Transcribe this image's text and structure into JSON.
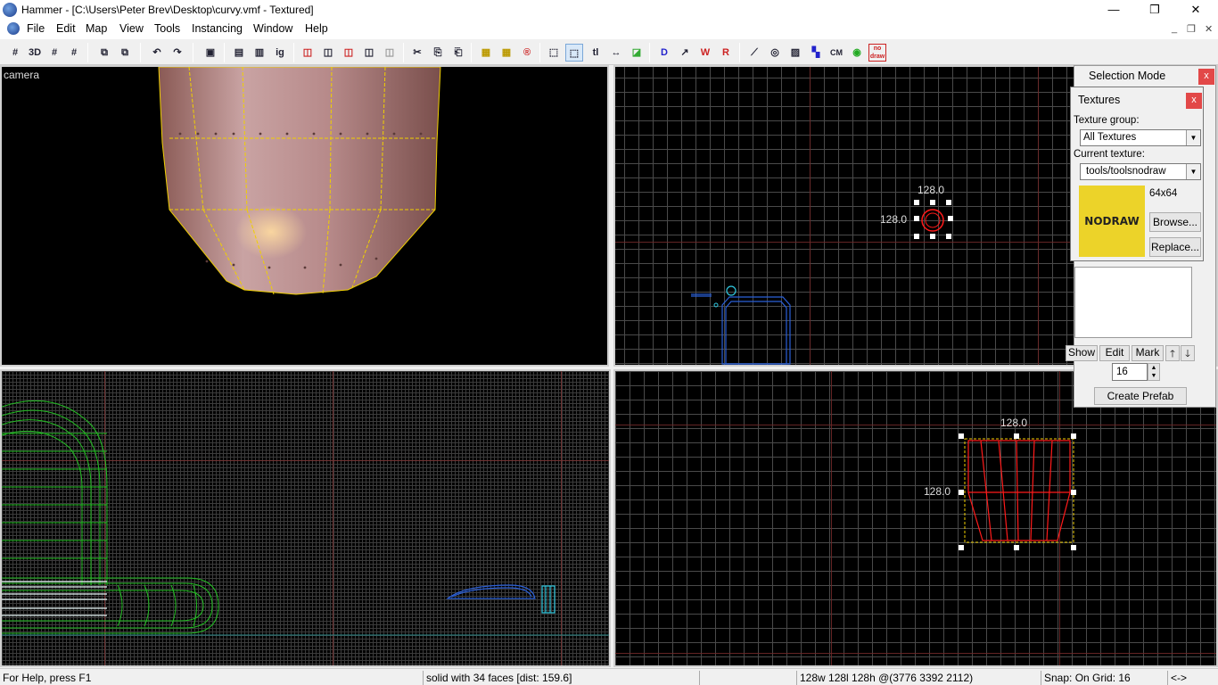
{
  "window": {
    "title": "Hammer - [C:\\Users\\Peter Brev\\Desktop\\curvy.vmf - Textured]",
    "minimize": "—",
    "maximize": "❐",
    "close": "✕"
  },
  "menu": {
    "items": [
      "File",
      "Edit",
      "Map",
      "View",
      "Tools",
      "Instancing",
      "Window",
      "Help"
    ],
    "mdi_min": "_",
    "mdi_restore": "❐",
    "mdi_close": "✕"
  },
  "toolbar": {
    "buttons": [
      "#",
      "3D",
      "#",
      "#",
      "⧉",
      "⧉",
      "↶",
      "↷",
      "▣",
      "▤",
      "▥",
      "ig",
      "◫",
      "◫",
      "◫",
      "◫",
      "◫",
      "✂",
      "⎘",
      "⎗",
      "▦",
      "▦",
      "®",
      "⬚",
      "⬚",
      "tl",
      "↔",
      "◪",
      "D",
      "↗",
      "W",
      "R",
      "⟋",
      "◎",
      "▨",
      "▚",
      "CM",
      "◉",
      "no draw"
    ]
  },
  "viewports": {
    "camera_label": "camera",
    "top_dims": {
      "w": "128.0",
      "h": "128.0"
    },
    "side_dims": {
      "w": "128.0",
      "h": "128.0"
    }
  },
  "selection_mode_panel": {
    "title": "Selection Mode",
    "close": "x"
  },
  "textures_panel": {
    "title": "Textures",
    "close": "x",
    "texture_group_label": "Texture group:",
    "texture_group_value": "All Textures",
    "current_texture_label": "Current texture:",
    "current_texture_value": "tools/toolsnodraw",
    "texture_size": "64x64",
    "texture_preview_text": "NODRAW",
    "browse": "Browse...",
    "replace": "Replace..."
  },
  "visgroup_panel": {
    "show": "Show",
    "edit": "Edit",
    "mark": "Mark",
    "up": "🡑",
    "down": "🡓",
    "spin_value": "16",
    "create_prefab": "Create Prefab"
  },
  "status": {
    "help": "For Help, press F1",
    "selection": "solid with 34 faces  [dist: 159.6]",
    "size": "128w 128l 128h @(3776 3392 2112)",
    "snap": "Snap: On Grid: 16",
    "arrows": "<->"
  },
  "colors": {
    "selection": "#ff1a1a",
    "bbox": "#ffd400",
    "brush_green": "#22c022",
    "brush_blue": "#2a5fd8",
    "brush_cyan": "#30c8e0"
  }
}
